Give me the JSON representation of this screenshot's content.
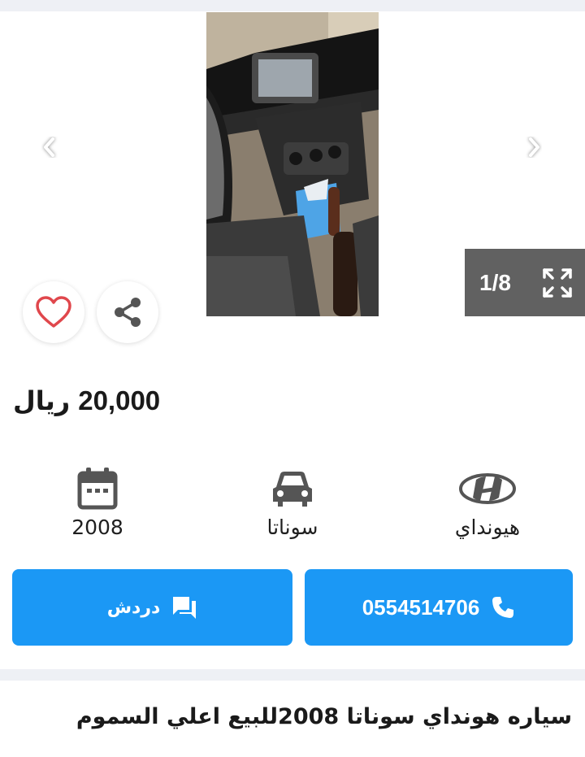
{
  "gallery": {
    "photo_alt": "car interior",
    "counter": "1/8",
    "prev_icon": "chevron-left-icon",
    "next_icon": "chevron-right-icon",
    "expand_icon": "expand-icon"
  },
  "actions": {
    "favorite_icon": "heart-icon",
    "share_icon": "share-icon"
  },
  "listing": {
    "price_amount": "20,000",
    "price_currency": "ريال",
    "title": "سياره هونداي سوناتا 2008للبيع اعلي السموم"
  },
  "specs": {
    "year": "2008",
    "model": "سوناتا",
    "brand": "هيونداي"
  },
  "buttons": {
    "chat_label": "دردش",
    "phone_number": "0554514706"
  },
  "colors": {
    "accent": "#1b98f5",
    "counter_bg": "#616161",
    "heart": "#e0474c",
    "background_strip": "#eef0f5"
  }
}
